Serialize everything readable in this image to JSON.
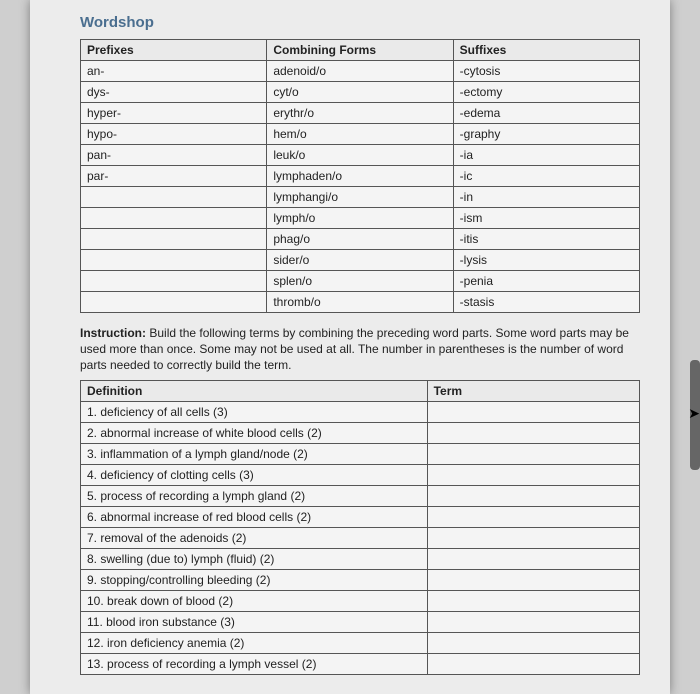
{
  "title": "Wordshop",
  "vocab": {
    "headers": [
      "Prefixes",
      "Combining Forms",
      "Suffixes"
    ],
    "rows": [
      [
        "an-",
        "adenoid/o",
        "-cytosis"
      ],
      [
        "dys-",
        "cyt/o",
        "-ectomy"
      ],
      [
        "hyper-",
        "erythr/o",
        "-edema"
      ],
      [
        "hypo-",
        "hem/o",
        "-graphy"
      ],
      [
        "pan-",
        "leuk/o",
        "-ia"
      ],
      [
        "par-",
        "lymphaden/o",
        "-ic"
      ],
      [
        "",
        "lymphangi/o",
        "-in"
      ],
      [
        "",
        "lymph/o",
        "-ism"
      ],
      [
        "",
        "phag/o",
        "-itis"
      ],
      [
        "",
        "sider/o",
        "-lysis"
      ],
      [
        "",
        "splen/o",
        "-penia"
      ],
      [
        "",
        "thromb/o",
        "-stasis"
      ]
    ]
  },
  "instruction_label": "Instruction:",
  "instruction": "Build the following terms by combining the preceding word parts. Some word parts may be used more than once. Some may not be used at all. The number in parentheses is the number of word parts needed to correctly build the term.",
  "defs": {
    "headers": [
      "Definition",
      "Term"
    ],
    "rows": [
      "1. deficiency of all cells (3)",
      "2. abnormal increase of white blood cells (2)",
      "3. inflammation of a lymph gland/node (2)",
      "4. deficiency of clotting cells (3)",
      "5. process of recording a lymph gland (2)",
      "6. abnormal increase of red blood cells (2)",
      "7. removal of the adenoids (2)",
      "8. swelling (due to) lymph (fluid) (2)",
      "9. stopping/controlling bleeding (2)",
      "10. break down of blood (2)",
      "11. blood iron substance (3)",
      "12. iron deficiency anemia (2)",
      "13. process of recording a lymph vessel (2)"
    ]
  }
}
